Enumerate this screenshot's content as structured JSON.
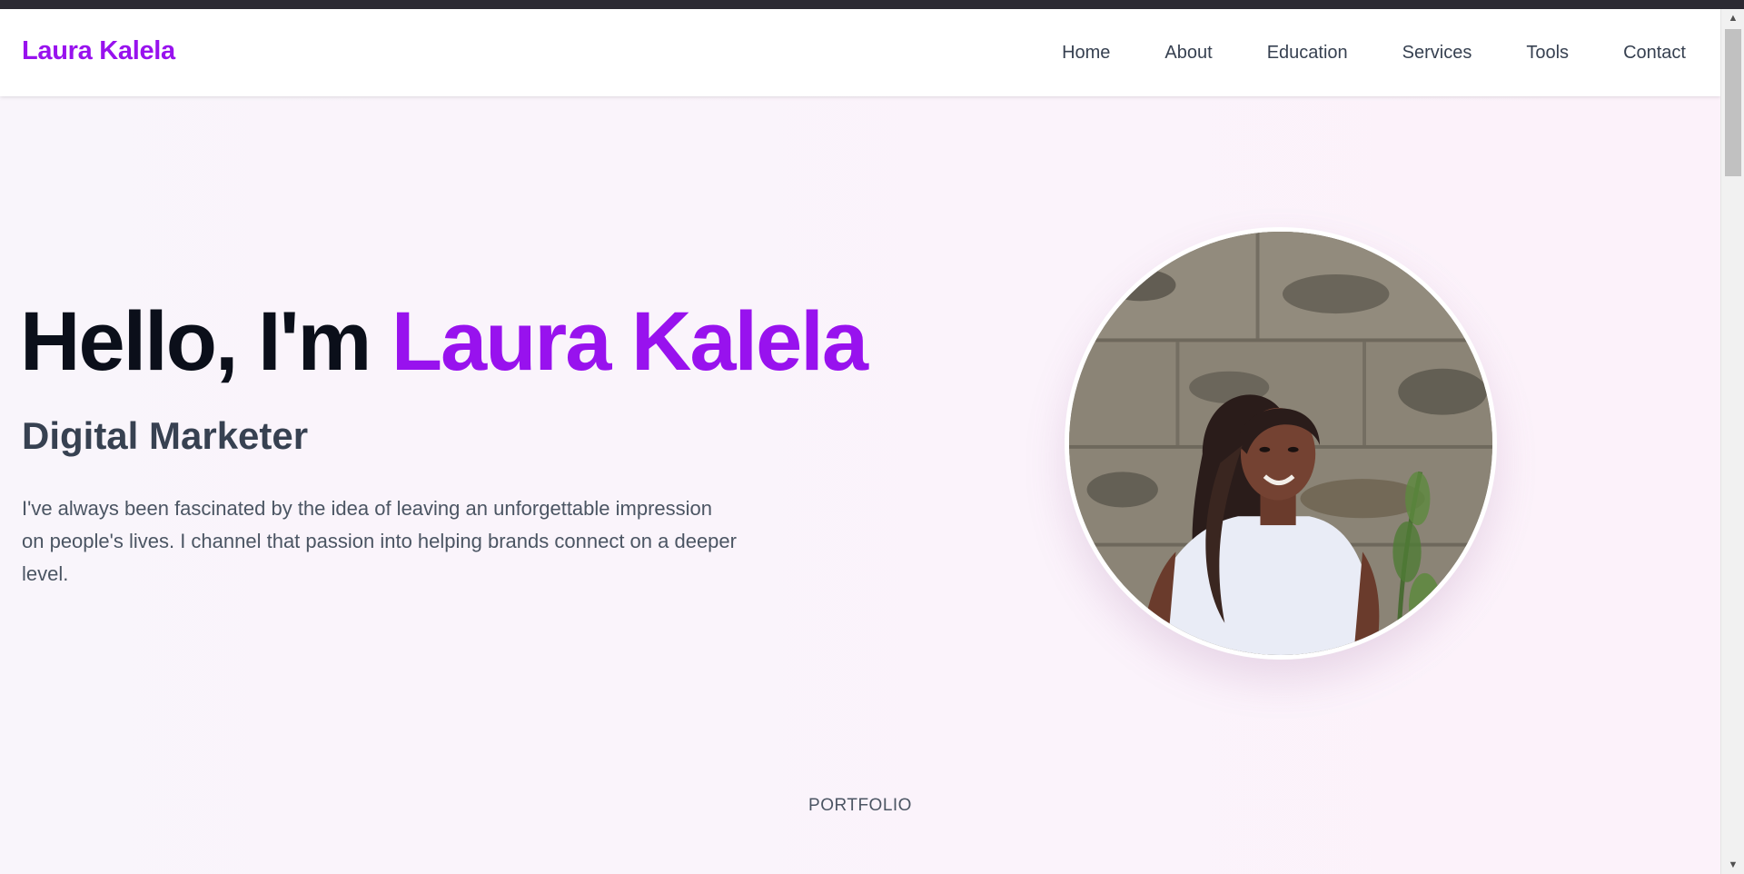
{
  "nav": {
    "brand": "Laura Kalela",
    "links": [
      "Home",
      "About",
      "Education",
      "Services",
      "Tools",
      "Contact"
    ]
  },
  "hero": {
    "greeting": "Hello, I'm ",
    "name": "Laura Kalela",
    "role": "Digital Marketer",
    "bio": "I've always been fascinated by the idea of leaving an unforgettable impression on people's lives. I channel that passion into helping brands connect on a deeper level.",
    "portrait_icon": "profile-photo"
  },
  "section_label": "PORTFOLIO",
  "colors": {
    "accent": "#9812ee",
    "heading": "#0b0f1a",
    "text": "#374151",
    "background": "#fbf6fb"
  },
  "scrollbar": {
    "up_icon": "chevron-up-icon",
    "down_icon": "chevron-down-icon"
  }
}
